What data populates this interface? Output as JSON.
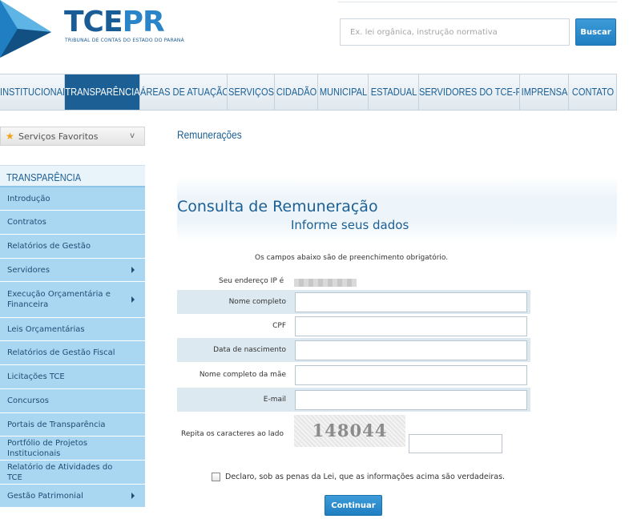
{
  "header": {
    "logo_tce": "TCE",
    "logo_pr": "PR",
    "logo_subtitle": "TRIBUNAL DE CONTAS DO ESTADO DO PARANÁ",
    "search_placeholder": "Ex. lei orgânica, instrução normativa",
    "search_button": "Buscar"
  },
  "nav": {
    "items": [
      {
        "label": "INSTITUCIONAL",
        "width": 81
      },
      {
        "label": "TRANSPARÊNCIA",
        "width": 94,
        "active": true
      },
      {
        "label": "ÁREAS DE ATUAÇÃO",
        "width": 109
      },
      {
        "label": "SERVIÇOS",
        "width": 59
      },
      {
        "label": "CIDADÃO",
        "width": 54
      },
      {
        "label": "MUNICIPAL",
        "width": 63
      },
      {
        "label": "ESTADUAL",
        "width": 63
      },
      {
        "label": "SERVIDORES DO TCE-PR",
        "width": 126
      },
      {
        "label": "IMPRENSA",
        "width": 61
      },
      {
        "label": "CONTATO",
        "width": 60
      }
    ]
  },
  "sidebar": {
    "favorites_label": "Serviços Favoritos",
    "favorites_chevron": "v",
    "section_title": "TRANSPARÊNCIA",
    "items": [
      {
        "label": "Introdução",
        "has_submenu": false,
        "height": 29
      },
      {
        "label": "Contratos",
        "has_submenu": false,
        "height": 30
      },
      {
        "label": "Relatórios de Gestão",
        "has_submenu": false,
        "height": 30
      },
      {
        "label": "Servidores",
        "has_submenu": true,
        "height": 29
      },
      {
        "label": "Execução Orçamentária e Financeira",
        "has_submenu": true,
        "height": 45
      },
      {
        "label": "Leis Orçamentárias",
        "has_submenu": false,
        "height": 29
      },
      {
        "label": "Relatórios de Gestão Fiscal",
        "has_submenu": false,
        "height": 30
      },
      {
        "label": "Licitações TCE",
        "has_submenu": false,
        "height": 30
      },
      {
        "label": "Concursos",
        "has_submenu": false,
        "height": 30
      },
      {
        "label": "Portais de Transparência",
        "has_submenu": false,
        "height": 29
      },
      {
        "label": "Portfólio de Projetos Institucionais",
        "has_submenu": false,
        "height": 30
      },
      {
        "label": "Relatório de Atividades do TCE",
        "has_submenu": false,
        "height": 30
      },
      {
        "label": "Gestão Patrimonial",
        "has_submenu": true,
        "height": 29
      }
    ]
  },
  "main": {
    "page_title": "Remunerações",
    "heading": "Consulta de Remuneração",
    "subheading": "Informe seus dados",
    "notice": "Os campos abaixo são de preenchimento obrigatório.",
    "ip_label": "Seu endereço IP é",
    "fields": [
      {
        "label": "Nome completo",
        "value": ""
      },
      {
        "label": "CPF",
        "value": ""
      },
      {
        "label": "Data de nascimento",
        "value": ""
      },
      {
        "label": "Nome completo da mãe",
        "value": ""
      },
      {
        "label": "E-mail",
        "value": ""
      }
    ],
    "captcha_label": "Repita os caracteres ao lado",
    "captcha_text": "148044",
    "captcha_value": "",
    "declaration": "Declaro, sob as penas da Lei, que as informações acima são verdadeiras.",
    "declaration_checked": false,
    "submit_label": "Continuar"
  },
  "colors": {
    "brand_blue": "#1b5f94",
    "button_blue": "#2a85c8",
    "sidebar_blue": "#a9d6f0"
  }
}
